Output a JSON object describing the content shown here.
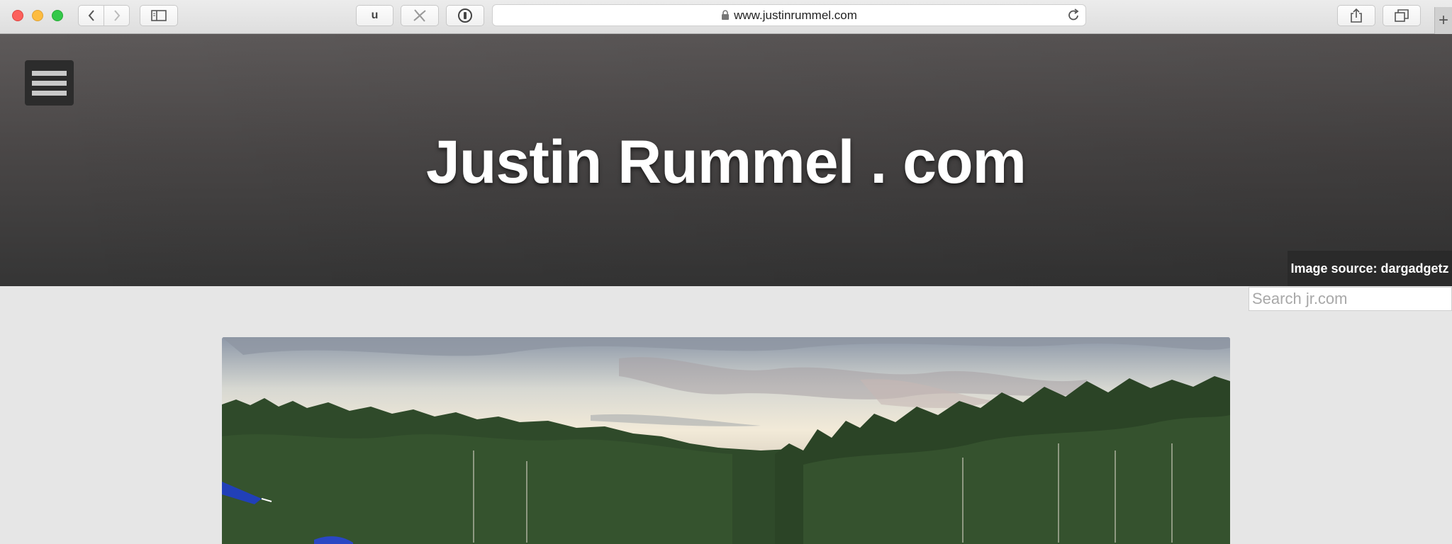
{
  "browser": {
    "url": "www.justinrummel.com",
    "ext_u_label": "u",
    "icons": [
      "back-icon",
      "forward-icon",
      "sidebar-icon",
      "pinwheel-icon",
      "password-icon",
      "lock-icon",
      "reload-icon",
      "share-icon",
      "tabs-icon",
      "new-tab-icon"
    ],
    "new_tab_label": "+"
  },
  "header": {
    "site_title": "Justin Rummel . com",
    "image_source": "Image source: dargadgetz",
    "menu_icon": "hamburger-icon"
  },
  "search": {
    "placeholder": "Search jr.com",
    "value": ""
  },
  "colors": {
    "header_bg": "#4a4747",
    "page_bg": "#e6e6e6",
    "title_text": "#ffffff"
  }
}
